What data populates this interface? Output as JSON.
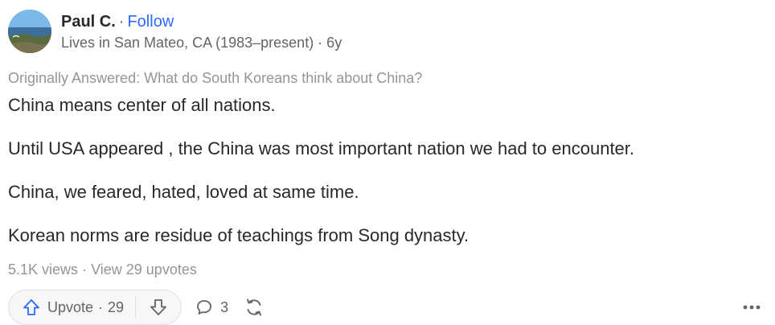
{
  "author": {
    "name": "Paul C.",
    "separator": "·",
    "follow_label": "Follow",
    "credential": "Lives in San Mateo, CA (1983–present) · 6y",
    "avatar_icon": "avatar-photo"
  },
  "question": {
    "originally_answered": "Originally Answered: What do South Koreans think about China?"
  },
  "answer": {
    "paragraphs": [
      "China means center of all nations.",
      "Until USA appeared , the China was most important nation we had to encounter.",
      "China, we feared, hated, loved at same time.",
      "Korean norms are residue of teachings from Song dynasty."
    ]
  },
  "stats": {
    "views": "5.1K views",
    "separator": "·",
    "upvotes_link": "View 29 upvotes"
  },
  "actions": {
    "upvote_label": "Upvote",
    "upvote_separator": "·",
    "upvote_count": "29",
    "comment_count": "3",
    "icons": [
      "upvote-arrow-icon",
      "downvote-arrow-icon",
      "comment-icon",
      "share-icon",
      "more-options-icon"
    ]
  },
  "colors": {
    "text": "#282829",
    "muted": "#636466",
    "light": "#939598",
    "link": "#2e69ff"
  }
}
